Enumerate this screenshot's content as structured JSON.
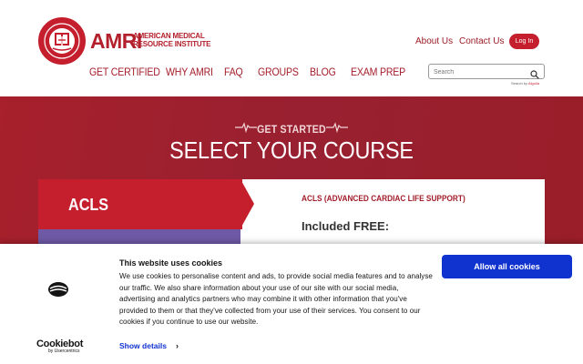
{
  "brand": {
    "short": "AMRI",
    "line1": "AMERICAN MEDICAL",
    "line2": "RESOURCE INSTITUTE"
  },
  "top_links": {
    "about": "About Us",
    "contact": "Contact Us",
    "login": "Log In"
  },
  "nav": [
    "GET CERTIFIED",
    "WHY AMRI",
    "FAQ",
    "GROUPS",
    "BLOG",
    "EXAM PREP"
  ],
  "search": {
    "placeholder": "Search",
    "powered_prefix": "Search by",
    "powered_brand": "Algolia"
  },
  "hero": {
    "kicker": "GET STARTED",
    "title": "SELECT YOUR COURSE"
  },
  "course": {
    "tab_label": "ACLS",
    "full_name": "ACLS (ADVANCED CARDIAC LIFE SUPPORT)",
    "included": "Included FREE:"
  },
  "cookie_banner": {
    "title": "This website uses cookies",
    "body": "We use cookies to personalise content and ads, to provide social media features and to analyse our traffic. We also share information about your use of our site with our social media, advertising and analytics partners who may combine it with other information that you've provided to them or that they've collected from your use of their services. You consent to our cookies if you continue to use our website.",
    "show_details": "Show details",
    "allow_all": "Allow all cookies",
    "provider": "Cookiebot",
    "provider_by": "by Usercentrics"
  },
  "colors": {
    "brand_red": "#c51f2e",
    "hero_red": "#9f1f2a",
    "purple_tab": "#6e59a6",
    "cookie_blue": "#1032cf"
  },
  "icons": [
    "seal-logo-icon",
    "search-icon",
    "pulse-icon",
    "cookiebot-icon",
    "chevron-right-icon"
  ]
}
